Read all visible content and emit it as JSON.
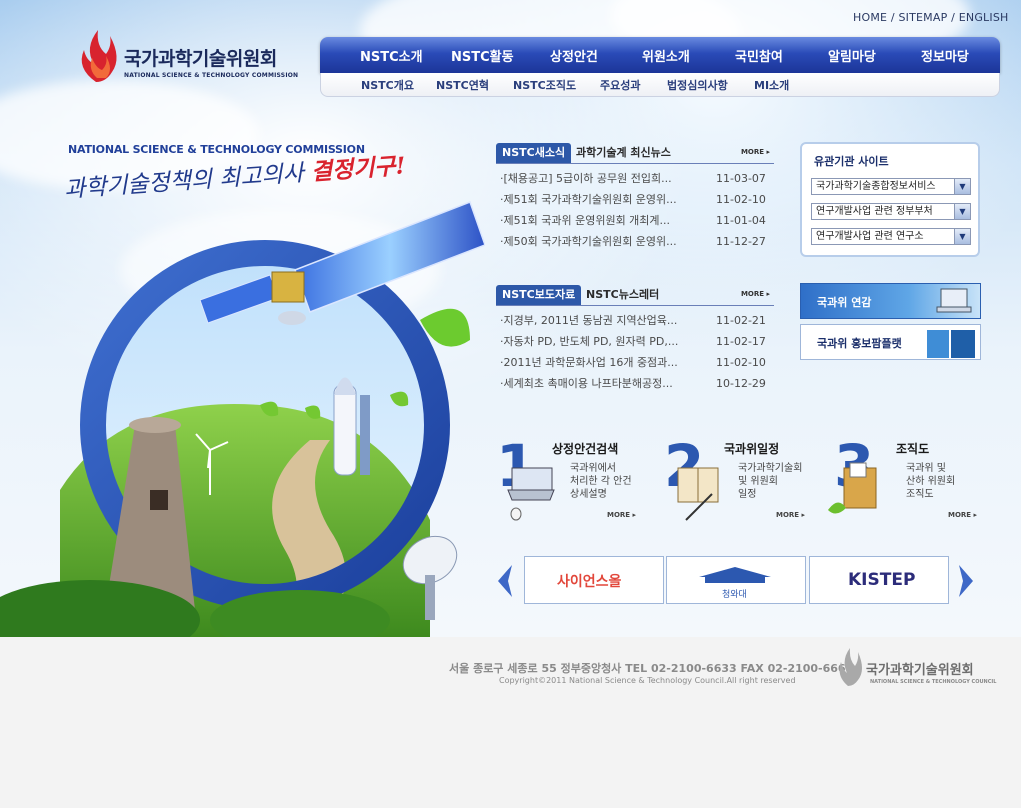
{
  "util_links": [
    "HOME",
    "SITEMAP",
    "ENGLISH"
  ],
  "util_sep": "/",
  "logo": {
    "ko": "국가과학기술위원회",
    "en": "NATIONAL SCIENCE & TECHNOLOGY COMMISSION"
  },
  "gnb": [
    "NSTC소개",
    "NSTC활동",
    "상정안건",
    "위원소개",
    "국민참여",
    "알림마당",
    "정보마당"
  ],
  "lnb": [
    "NSTC개요",
    "NSTC연혁",
    "NSTC조직도",
    "주요성과",
    "법정심의사항",
    "MI소개"
  ],
  "hero": {
    "eng": "NATIONAL SCIENCE & TECHNOLOGY COMMISSION",
    "slogan_a": "과학기술정책의 최고의사",
    "slogan_b": "결정기구!"
  },
  "news": {
    "tab_active": "NSTC새소식",
    "tab_other": "과학기술계 최신뉴스",
    "more": "MORE",
    "items": [
      {
        "title": "[채용공고] 5급이하 공무원 전입희...",
        "date": "11-03-07"
      },
      {
        "title": "제51회 국가과학기술위원회 운영위...",
        "date": "11-02-10"
      },
      {
        "title": "제51회 국과위 운영위원회 개최계...",
        "date": "11-01-04"
      },
      {
        "title": "제50회 국가과학기술위원회 운영위...",
        "date": "11-12-27"
      }
    ]
  },
  "press": {
    "tab_active": "NSTC보도자료",
    "tab_other": "NSTC뉴스레터",
    "more": "MORE",
    "items": [
      {
        "title": "지경부, 2011년 동남권 지역산업육...",
        "date": "11-02-21"
      },
      {
        "title": "자동차 PD, 반도체 PD, 원자력 PD,...",
        "date": "11-02-17"
      },
      {
        "title": "2011년 과학문화사업 16개 중점과...",
        "date": "11-02-10"
      },
      {
        "title": "세계최초 촉매이용 나프타분해공정...",
        "date": "10-12-29"
      }
    ]
  },
  "related": {
    "title": "유관기관 사이트",
    "selects": [
      "국가과학기술종합정보서비스",
      "연구개발사업 관련 정부부처",
      "연구개발사업 관련 연구소"
    ]
  },
  "banners": [
    "국과위 연감",
    "국과위 홍보팜플랫"
  ],
  "steps": [
    {
      "num": "1",
      "title": "상정안건검색",
      "desc": "국과위에서\n처리한 각 안건\n상세설명",
      "more": "MORE"
    },
    {
      "num": "2",
      "title": "국과위일정",
      "desc": "국가과학기술회\n및 위원회\n일정",
      "more": "MORE"
    },
    {
      "num": "3",
      "title": "조직도",
      "desc": "국과위 및\n산하 위원회\n조직도",
      "more": "MORE"
    }
  ],
  "links": [
    "사이언스올",
    "청와대",
    "KISTEP"
  ],
  "footer": {
    "address": "서울 종로구 세종로 55 정부중앙청사   TEL 02-2100-6633    FAX 02-2100-6665",
    "copyright": "Copyright©2011 National Science & Technology Council.All right reserved",
    "logo_ko": "국가과학기술위원회",
    "logo_en": "NATIONAL SCIENCE & TECHNOLOGY COUNCIL"
  },
  "colors": {
    "primary": "#2c58b0",
    "accent_red": "#d9232e",
    "nav": "#2a4bb8"
  }
}
